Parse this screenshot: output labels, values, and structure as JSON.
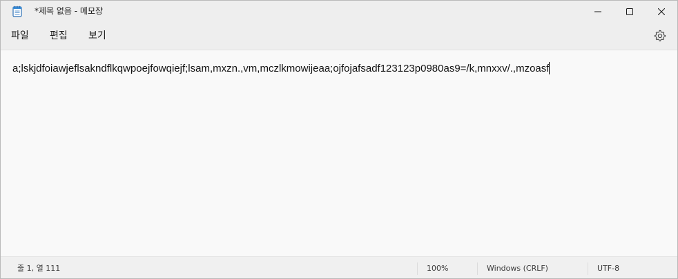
{
  "window": {
    "title": "*제목 없음 - 메모장",
    "app_icon": "notepad-icon"
  },
  "caption_buttons": {
    "minimize_icon": "minimize-icon",
    "maximize_icon": "maximize-icon",
    "close_icon": "close-icon"
  },
  "menu": {
    "file": "파일",
    "edit": "편집",
    "view": "보기",
    "settings_icon": "gear-icon"
  },
  "editor": {
    "content": "a;lskjdfoiawjeflsakndflkqwpoejfowqiejf;lsam,mxzn.,vm,mczlkmowijeaa;ojfojafsadf123123p0980as9=/k,mnxxv/.,mzoasf"
  },
  "statusbar": {
    "position": "줄 1, 열 111",
    "zoom": "100%",
    "line_ending": "Windows (CRLF)",
    "encoding": "UTF-8"
  }
}
